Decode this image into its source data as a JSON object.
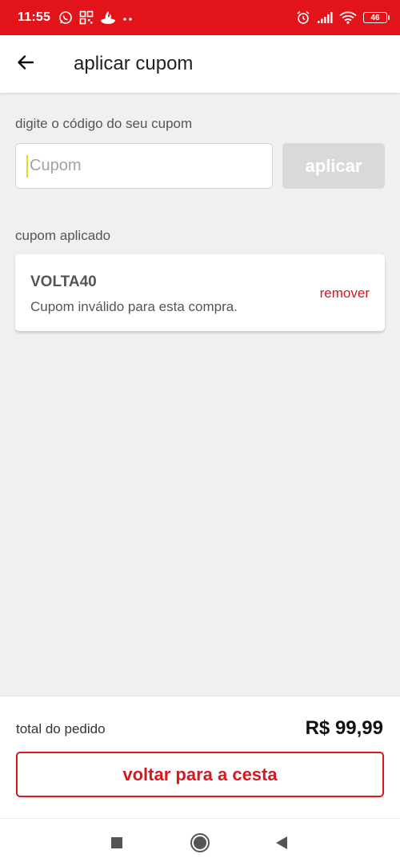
{
  "status_bar": {
    "time": "11:55",
    "battery": "46",
    "icons": [
      "whatsapp-icon",
      "qr-grid-icon",
      "santander-flame-icon",
      "more-dots-icon",
      "alarm-icon",
      "signal-icon",
      "wifi-icon",
      "battery-icon"
    ],
    "background_color": "#e3131b"
  },
  "header": {
    "back_icon": "arrow-left-icon",
    "title": "aplicar cupom"
  },
  "coupon_form": {
    "label": "digite o código do seu cupom",
    "input_value": "",
    "input_placeholder": "Cupom",
    "apply_label": "aplicar"
  },
  "applied_coupon": {
    "section_label": "cupom aplicado",
    "code": "VOLTA40",
    "message": "Cupom inválido para esta compra.",
    "remove_label": "remover"
  },
  "footer": {
    "total_label": "total do pedido",
    "total_value": "R$ 99,99",
    "back_to_cart_label": "voltar para a cesta"
  },
  "nav_bar": {
    "icons": [
      "recents-square-icon",
      "home-circle-icon",
      "back-triangle-icon"
    ]
  },
  "colors": {
    "accent_red": "#d8171f",
    "disabled_button": "#d9d9d9",
    "background": "#f0f0f0"
  }
}
